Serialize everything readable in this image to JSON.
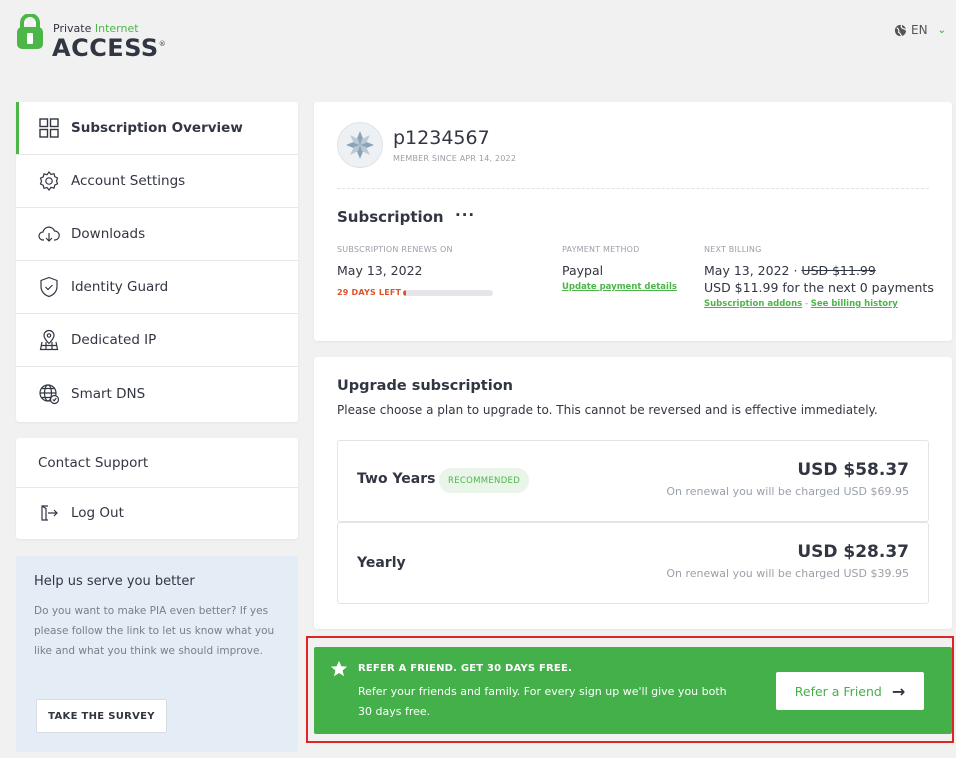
{
  "header": {
    "logo_line1_a": "Private",
    "logo_line1_b": "Internet",
    "logo_line2": "ACCESS",
    "logo_mark": "®",
    "lang": "EN"
  },
  "sidebar": {
    "items": [
      {
        "label": "Subscription Overview",
        "icon": "grid-icon",
        "active": true
      },
      {
        "label": "Account Settings",
        "icon": "gear-icon"
      },
      {
        "label": "Downloads",
        "icon": "cloud-download-icon"
      },
      {
        "label": "Identity Guard",
        "icon": "shield-check-icon"
      },
      {
        "label": "Dedicated IP",
        "icon": "location-pin-icon"
      },
      {
        "label": "Smart DNS",
        "icon": "globe-icon"
      }
    ],
    "contact_support": "Contact Support",
    "logout": "Log Out"
  },
  "survey": {
    "title": "Help us serve you better",
    "text": "Do you want to make PIA even better? If yes please follow the link to let us know what you like and what you think we should improve.",
    "button": "TAKE THE SURVEY"
  },
  "profile": {
    "username": "p1234567",
    "member_since": "MEMBER SINCE APR 14, 2022"
  },
  "subscription": {
    "title": "Subscription",
    "dots": "···",
    "renews_label": "SUBSCRIPTION RENEWS ON",
    "renews_value": "May 13, 2022",
    "days_left": "29 DAYS LEFT",
    "days_left_fraction": 0.03,
    "payment_label": "PAYMENT METHOD",
    "payment_value": "Paypal",
    "update_payment": "Update payment details",
    "next_billing_label": "NEXT BILLING",
    "next_billing_date": "May 13, 2022 ·",
    "next_billing_old": "USD $11.99",
    "next_billing_text": "USD $11.99 for the next 0 payments",
    "addons_link": "Subscription addons",
    "addons_sep": "-",
    "history_link": "See billing history"
  },
  "upgrade": {
    "title": "Upgrade subscription",
    "description": "Please choose a plan to upgrade to. This cannot be reversed and is effective immediately.",
    "plans": [
      {
        "name": "Two Years",
        "badge": "RECOMMENDED",
        "price": "USD $58.37",
        "renewal": "On renewal you will be charged USD $69.95"
      },
      {
        "name": "Yearly",
        "price": "USD $28.37",
        "renewal": "On renewal you will be charged USD $39.95"
      }
    ]
  },
  "refer": {
    "title": "REFER A FRIEND. GET 30 DAYS FREE.",
    "text": "Refer your friends and family. For every sign up we'll give you both 30 days free.",
    "button": "Refer a Friend",
    "arrow": "→"
  },
  "colors": {
    "brand_green": "#4cb649",
    "banner_green": "#44b04a",
    "warning_red": "#e1522b",
    "highlight_red": "#e02424"
  }
}
